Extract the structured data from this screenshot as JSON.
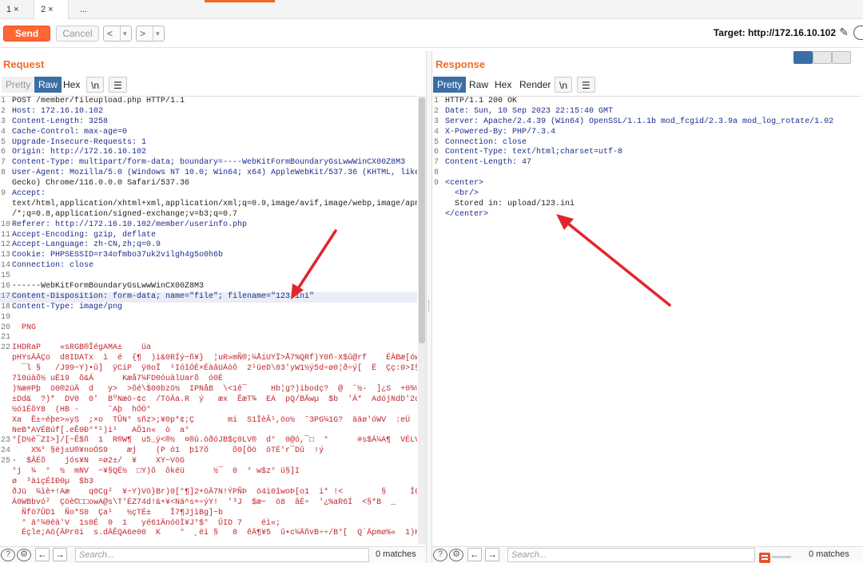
{
  "tabs": [
    {
      "label": "1 ×"
    },
    {
      "label": "2 ×"
    },
    {
      "label": "..."
    }
  ],
  "toolbar": {
    "send_label": "Send",
    "cancel_label": "Cancel",
    "back_label": "<",
    "forward_label": ">",
    "dropdown_glyph": "▾",
    "target_label": "Target: http://172.16.10.102",
    "pencil_glyph": "✎"
  },
  "request": {
    "title": "Request",
    "tabs": [
      {
        "label": "Pretty"
      },
      {
        "label": "Raw"
      },
      {
        "label": "Hex"
      },
      {
        "label": "\\n"
      },
      {
        "label": "☰"
      }
    ],
    "lines": [
      {
        "n": "1",
        "code": "POST /member/fileupload.php HTTP/1.1"
      },
      {
        "n": "2",
        "code": "Host: 172.16.10.102"
      },
      {
        "n": "3",
        "code": "Content-Length: 3258"
      },
      {
        "n": "4",
        "code": "Cache-Control: max-age=0"
      },
      {
        "n": "5",
        "code": "Upgrade-Insecure-Requests: 1"
      },
      {
        "n": "6",
        "code": "Origin: http://172.16.10.102"
      },
      {
        "n": "7",
        "code": "Content-Type: multipart/form-data; boundary=----WebKitFormBoundaryGsLwwWinCX00Z8M3"
      },
      {
        "n": "8",
        "code": "User-Agent: Mozilla/5.0 (Windows NT 10.0; Win64; x64) AppleWebKit/537.36 (KHTML, like"
      },
      {
        "n": "",
        "code": "Gecko) Chrome/116.0.0.0 Safari/537.36"
      },
      {
        "n": "9",
        "code": "Accept:"
      },
      {
        "n": "",
        "code": "text/html,application/xhtml+xml,application/xml;q=0.9,image/avif,image/webp,image/apng,*"
      },
      {
        "n": "",
        "code": "/*;q=0.8,application/signed-exchange;v=b3;q=0.7"
      },
      {
        "n": "10",
        "code": "Referer: http://172.16.10.102/member/userinfo.php"
      },
      {
        "n": "11",
        "code": "Accept-Encoding: gzip, deflate"
      },
      {
        "n": "12",
        "code": "Accept-Language: zh-CN,zh;q=0.9"
      },
      {
        "n": "13",
        "code": "Cookie: PHPSESSID=r34ofmbo37uk2vilgh4g5o0h6b"
      },
      {
        "n": "14",
        "code": "Connection: close"
      },
      {
        "n": "15",
        "code": ""
      },
      {
        "n": "16",
        "code": "------WebKitFormBoundaryGsLwwWinCX00Z8M3"
      },
      {
        "n": "17",
        "code": "Content-Disposition: form-data; name=\"file\"; filename=\"123.ini\""
      },
      {
        "n": "18",
        "code": "Content-Type: image/png"
      },
      {
        "n": "19",
        "code": ""
      },
      {
        "n": "20",
        "code": "  PNG"
      },
      {
        "n": "21",
        "code": ""
      },
      {
        "n": "22",
        "code": "IHDRaP    «sRGB®ÎégAMA±    üa"
      },
      {
        "n": "",
        "code": "pHYsÄÄÇo  d8IDATx  ì  é  {¶  )i&0RÍý~ñ¥}  ¦uR»mÑ®;¼ÅíUYÏ>Å7%QRf)Y0ñ-X$û@rf    ÉÀBæ[óws-"
      },
      {
        "n": "",
        "code": "  ¯l §   /J99~Y)•û]  ÿCiP  ÿ0oÎ  ¹IóîÓÉ×ÉàâUÁòô  2¹üeD\\03'yW1½ý5d÷ø0¦ð÷ý[  Ë  Çç:0>I§"
      },
      {
        "n": "",
        "code": "7î0úàõ½ uË19  õ&Á      Kæå7¼FD0óuàlUarõ  ó0É"
      },
      {
        "n": "",
        "code": ")%æ#Pþ  ö0®2üÄ  d   y>  >õé\\$00bzö½  IPNåB  \\<1ê¯     Hb¦g?)ibodç?  @  ˆ½-  ]¿S  +0¾½æCarü"
      },
      {
        "n": "",
        "code": "±Dd&  ?)*  DV0  0'  BºNæö-¢c  /TöÄa.R  ý   æx  ÊæT¾  EA  pQ/BÄwµ  $b  'Á*  AdójNdD'2oS"
      },
      {
        "n": "",
        "code": "½ó1ÉõY8  (HB -      ˆAþ  hÓÖ°"
      },
      {
        "n": "",
        "code": "Xa  Ê±÷éþe>»yS  ;×o  TÛN° sñz>;¥0p*¢;Ç       mi  S1ÎèÂ¹,öo½  ˜3PG¼1G?  ääø'óWV  :eÜ"
      },
      {
        "n": "",
        "code": "NeB*AVÉBúf[.eÊ0Ð°*¹)i¹   AÕ1n«  ò  a°"
      },
      {
        "n": "23",
        "code": "°[D½è¯ZI>]/[~Ê$ñ  1  R®W¶  u5_ý<®½  ¤®û.òðóJB$ç0LV®  d°  0@ó,¯□  °      #s$Á¼A¶  VÉLVV"
      },
      {
        "n": "24",
        "code": "    X%° §ëj±U®¥noÓS9    æj    (P ó1  þî7õ     õ0[Öö  öTÉ'r¯Dû  !ý"
      },
      {
        "n": "25",
        "code": "-  $ÂÉõ    jós¥N  =ø2±/  ¥    XY~VöG"
      },
      {
        "n": "",
        "code": "°j  ¼  °  ½  mNV  ~¥§QÉ½  □Y)ô  ôkéü      ½¯  0  ° w$z° ü§]I"
      },
      {
        "n": "",
        "code": "ø  ³àiçÉIÐ0µ  $b3"
      },
      {
        "n": "",
        "code": "ðJü  ¼ìè+!Aæ    q0Cg²  ¥~Y)Vö}Br)0[°¶]2+öÄ7N!ÝPÑÞ  ö4i0îwoÞ[o1  i* !<        §     Î0XBÚ."
      },
      {
        "n": "",
        "code": "Ä0WBbvó²  Çöè©□□owA@s\\T'ÉZ74d!&+¥<Nä^s+÷ýY!  '³J  $æ~  ö8  âÉ÷  '¿%aR6Í  <§*B  _"
      },
      {
        "n": "",
        "code": "  Ñfö7ÛD1  Ño*S0  Ça¹   ½çTÉ±    Î7¶JjìBg]~b"
      },
      {
        "n": "",
        "code": "  ° ä°¼0éà'V  1s0É  0  1   yé61ÄnóöÌ¥J°$°  ÛID 7    éì«;"
      },
      {
        "n": "",
        "code": "  Éçle;Aö{ÄPr0i  s.dÄÊQA6e00  K    °  ¸ëi §   8  êÄ¶¥5  û•c¼ÄñvB÷÷/B°[  Q´Äpmø%«  1)H°w"
      }
    ],
    "search_placeholder": "Search...",
    "matches_label": "0 matches"
  },
  "response": {
    "title": "Response",
    "tabs": [
      {
        "label": "Pretty"
      },
      {
        "label": "Raw"
      },
      {
        "label": "Hex"
      },
      {
        "label": "Render"
      },
      {
        "label": "\\n"
      },
      {
        "label": "☰"
      }
    ],
    "lines": [
      {
        "n": "1",
        "code": "HTTP/1.1 200 OK"
      },
      {
        "n": "2",
        "code": "Date: Sun, 10 Sep 2023 22:15:40 GMT"
      },
      {
        "n": "3",
        "code": "Server: Apache/2.4.39 (Win64) OpenSSL/1.1.1b mod_fcgid/2.3.9a mod_log_rotate/1.02"
      },
      {
        "n": "4",
        "code": "X-Powered-By: PHP/7.3.4"
      },
      {
        "n": "5",
        "code": "Connection: close"
      },
      {
        "n": "6",
        "code": "Content-Type: text/html;charset=utf-8"
      },
      {
        "n": "7",
        "code": "Content-Length: 47"
      },
      {
        "n": "8",
        "code": ""
      },
      {
        "n": "9",
        "code": "<center>"
      },
      {
        "n": "",
        "code": "  <br/>"
      },
      {
        "n": "",
        "code": "  Stored in: upload/123.ini"
      },
      {
        "n": "",
        "code": "</center>"
      }
    ],
    "search_placeholder": "Search...",
    "matches_label": "0 matches"
  },
  "colors": {
    "accent": "#ef6c2b",
    "send": "#ff6633",
    "active_tab": "#3a6ea5",
    "arrow": "#e0262c"
  }
}
